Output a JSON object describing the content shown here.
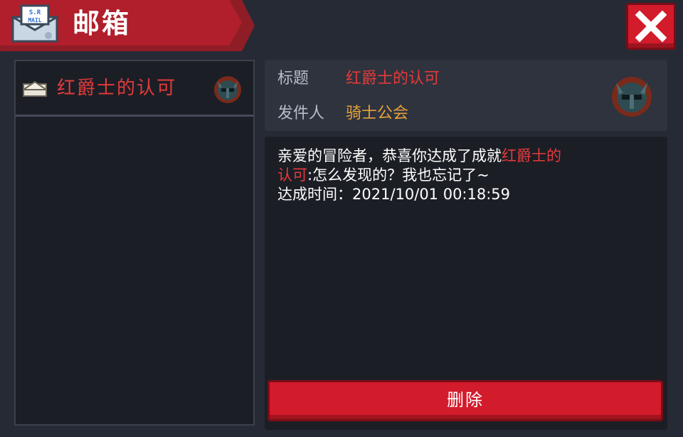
{
  "window": {
    "title": "邮箱",
    "close_icon": "close-icon"
  },
  "mail_list": {
    "items": [
      {
        "label": "红爵士的认可",
        "icon": "envelope-icon",
        "badge": "knight-helmet-icon"
      }
    ]
  },
  "mail_detail": {
    "subject_label": "标题",
    "subject_value": "红爵士的认可",
    "sender_label": "发件人",
    "sender_value": "骑士公会",
    "body": {
      "line1_prefix": "亲爱的冒险者，恭喜你达成了成就",
      "achievement_part1": "红爵士的",
      "achievement_part2": "认可",
      "line2_suffix": ":怎么发现的？我也忘记了~",
      "line3": "达成时间：2021/10/01 00:18:59"
    },
    "delete_label": "删除"
  },
  "colors": {
    "accent_red": "#d21b2b",
    "highlight_red": "#e43a3a",
    "sender_orange": "#e8a13a",
    "panel_bg": "#1c1e26"
  }
}
